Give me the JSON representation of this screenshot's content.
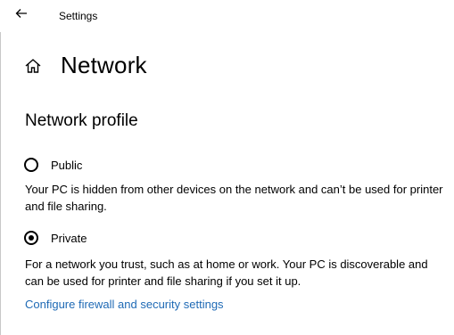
{
  "window": {
    "title": "Settings"
  },
  "header": {
    "page_title": "Network",
    "home_icon": "home-icon",
    "back_icon": "back-arrow-icon"
  },
  "network_profile": {
    "section_title": "Network profile",
    "options": [
      {
        "label": "Public",
        "selected": false,
        "description": "Your PC is hidden from other devices on the network and can’t be used for printer and file sharing."
      },
      {
        "label": "Private",
        "selected": true,
        "description": "For a network you trust, such as at home or work. Your PC is discoverable and can be used for printer and file sharing if you set it up."
      }
    ],
    "firewall_link": "Configure firewall and security settings"
  },
  "colors": {
    "link": "#1f6ab5",
    "text": "#000000",
    "background": "#ffffff"
  }
}
